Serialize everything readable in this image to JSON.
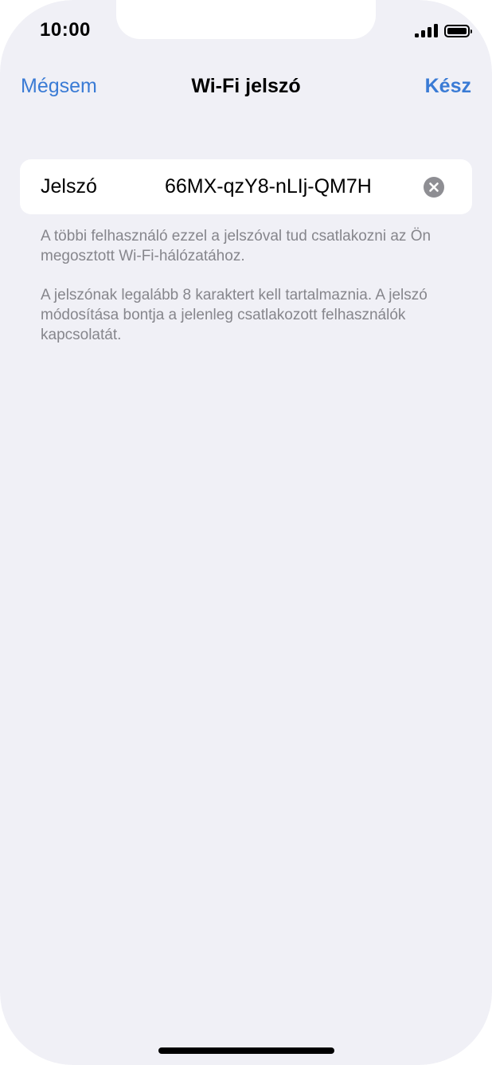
{
  "status_bar": {
    "time": "10:00"
  },
  "navbar": {
    "cancel_label": "Mégsem",
    "title": "Wi-Fi jelszó",
    "done_label": "Kész"
  },
  "password_field": {
    "label": "Jelszó",
    "value": "66MX-qzY8-nLIj-QM7H"
  },
  "footnotes": [
    "A többi felhasználó ezzel a jelszóval tud csatlakozni az Ön megosztott Wi-Fi-hálózatához.",
    "A jelszónak legalább 8 karaktert kell tartalmaznia. A jelszó módosítása bontja a jelenleg csatlakozott felhasználók kapcsolatát."
  ],
  "colors": {
    "accent": "#3a7bd5",
    "background": "#f0f0f6",
    "card": "#ffffff",
    "footnote_text": "#86868c"
  },
  "icons": {
    "signal": "cellular-signal-icon",
    "battery": "battery-icon",
    "clear": "clear-circle-icon"
  }
}
